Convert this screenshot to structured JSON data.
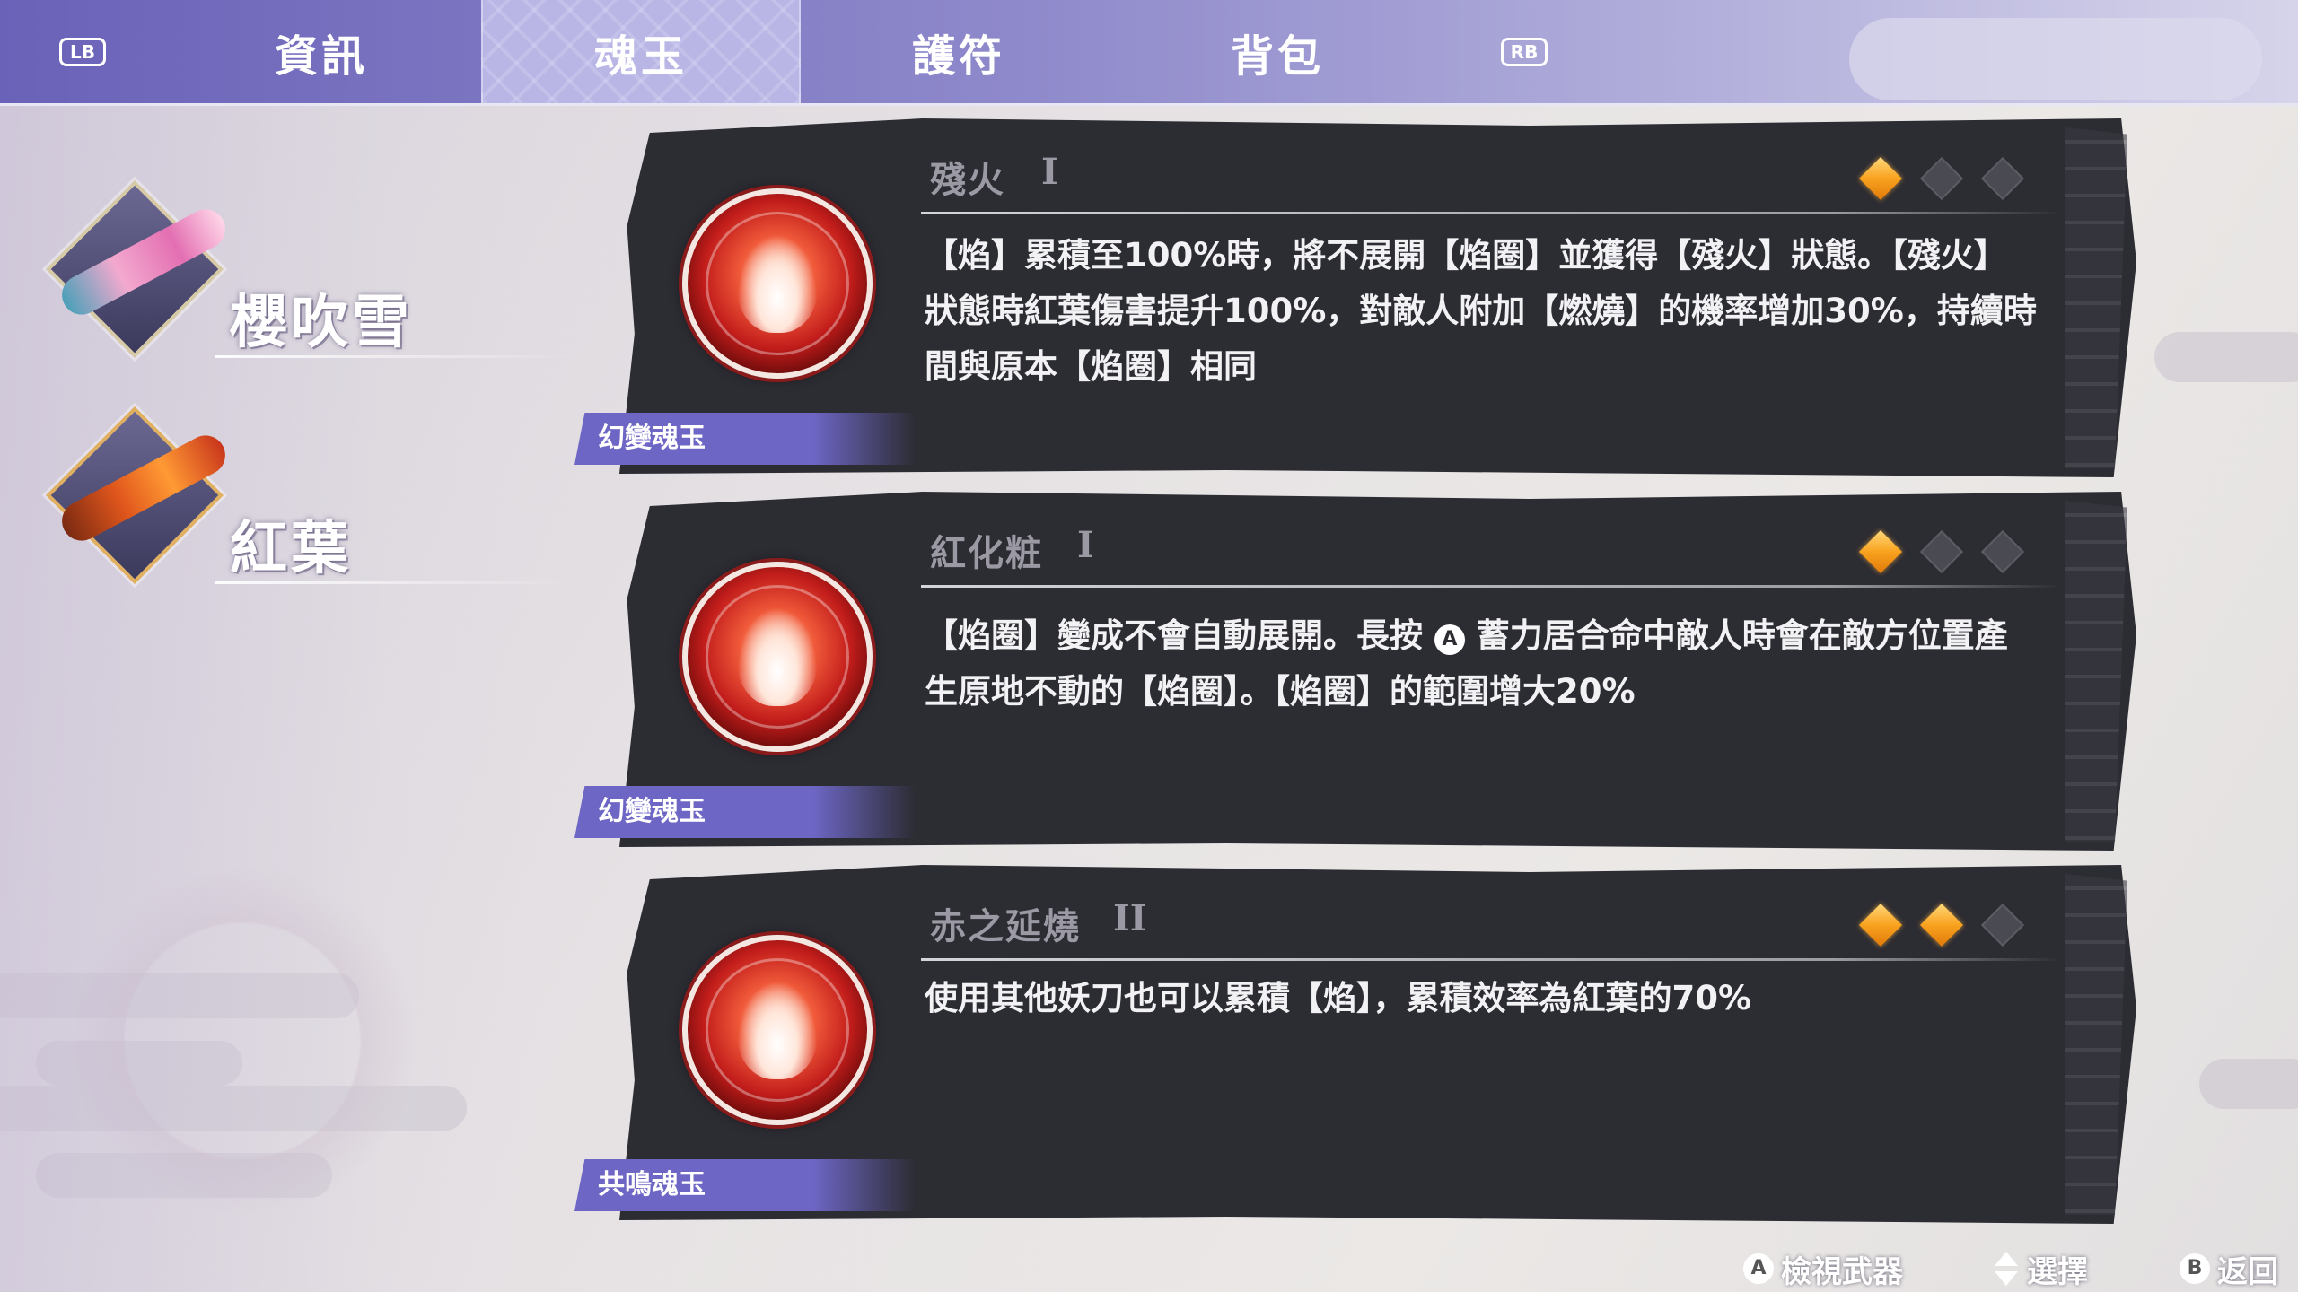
{
  "tabs": {
    "lb": "LB",
    "rb": "RB",
    "items": [
      "資訊",
      "魂玉",
      "護符",
      "背包"
    ],
    "active": "魂玉"
  },
  "weapons": [
    {
      "name": "櫻吹雪",
      "icon": "sakura-fubuki-sword-icon"
    },
    {
      "name": "紅葉",
      "icon": "momiji-sword-icon"
    }
  ],
  "cards": [
    {
      "title": "殘火",
      "tier": "I",
      "rank": 1,
      "rank_max": 3,
      "icon": "flame-soul-orb-icon",
      "desc": "【焰】累積至100%時，將不展開【焰圈】並獲得【殘火】狀態。【殘火】狀態時紅葉傷害提升100%，對敵人附加【燃燒】的機率增加30%，持續時間與原本【焰圈】相同",
      "type": "幻變魂玉"
    },
    {
      "title": "紅化粧",
      "tier": "I",
      "rank": 1,
      "rank_max": 3,
      "icon": "crossed-blades-flame-orb-icon",
      "desc_pre": "【焰圈】變成不會自動展開。長按",
      "desc_btn": "A",
      "desc_post": "蓄力居合命中敵人時會在敵方位置產生原地不動的【焰圈】。【焰圈】的範圍增大20%",
      "type": "幻變魂玉"
    },
    {
      "title": "赤之延燒",
      "tier": "II",
      "rank": 2,
      "rank_max": 3,
      "icon": "blazing-slashes-orb-icon",
      "desc": "使用其他妖刀也可以累積【焰】，累積效率為紅葉的70%",
      "type": "共鳴魂玉"
    }
  ],
  "hints": {
    "view_icon": "A",
    "view_label": "檢視武器",
    "select_label": "選擇",
    "back_icon": "B",
    "back_label": "返回"
  },
  "colors": {
    "accent": "#6d66c4",
    "gem_on": "#f9a21e",
    "card_bg": "#2c2c33"
  }
}
